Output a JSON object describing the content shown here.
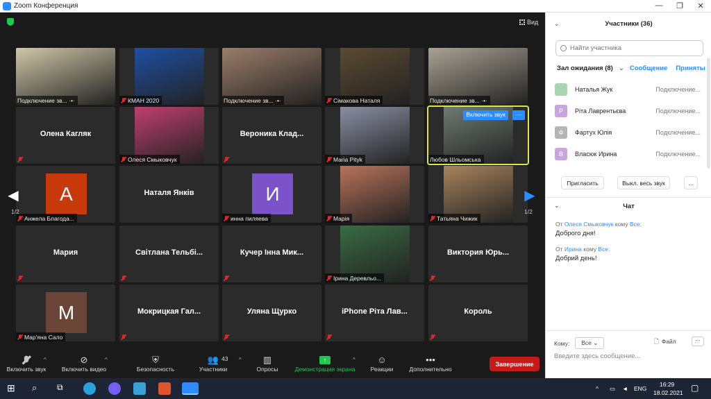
{
  "window": {
    "title": "Zoom Конференция",
    "view_label": "Вид"
  },
  "gallery": {
    "page_left": "1/2",
    "page_right": "1/2",
    "tiles": [
      {
        "name": "Подключение зв... ·•·",
        "type": "photo",
        "color": "#cfc7a8",
        "muted": false
      },
      {
        "name": "КМАН 2020",
        "type": "photo",
        "color": "#1e4fa3",
        "muted": true
      },
      {
        "name": "Подключение зв... ·•·",
        "type": "photo",
        "color": "#9a7d6a",
        "muted": false
      },
      {
        "name": "Сімакова Наталя",
        "type": "photo",
        "color": "#5b4a32",
        "muted": true
      },
      {
        "name": "Подключение зв... ·•·",
        "type": "photo",
        "color": "#a9a294",
        "muted": false
      },
      {
        "name": "Олена Кагляк",
        "type": "text",
        "muted": true
      },
      {
        "name": "Олеся Смыковчук",
        "type": "photo",
        "color": "#c03f6d",
        "muted": true
      },
      {
        "name": "Вероника  Клад...",
        "type": "text",
        "muted": true
      },
      {
        "name": "Maria Pityk",
        "type": "photo",
        "color": "#8b8fa3",
        "muted": true
      },
      {
        "name": "Любов Шльомська",
        "type": "photo",
        "color": "#6e7a72",
        "muted": false,
        "active": true
      },
      {
        "name": "Анжела Благода...",
        "type": "avatar",
        "letter": "A",
        "color": "#c8390c",
        "muted": true
      },
      {
        "name": "Наталя Янків",
        "type": "text",
        "muted": false
      },
      {
        "name": "инна пиляева",
        "type": "avatar",
        "letter": "И",
        "color": "#7b52c9",
        "muted": true
      },
      {
        "name": "Марія",
        "type": "photo",
        "color": "#b9735b",
        "muted": true
      },
      {
        "name": "Татьяна Чижик",
        "type": "photo",
        "color": "#a8845d",
        "muted": true
      },
      {
        "name": "Мария",
        "type": "text",
        "muted": true
      },
      {
        "name": "Світлана  Тельбі...",
        "type": "text",
        "muted": true
      },
      {
        "name": "Кучер Інна  Мик...",
        "type": "text",
        "muted": true
      },
      {
        "name": "Ірина Деревльо...",
        "type": "photo",
        "color": "#3a6b44",
        "muted": true
      },
      {
        "name": "Виктория  Юрь...",
        "type": "text",
        "muted": true
      },
      {
        "name": "Мар'яна Сало",
        "type": "avatar",
        "letter": "M",
        "color": "#6b4638",
        "muted": true
      },
      {
        "name": "Мокрицкая  Гал...",
        "type": "text",
        "muted": true
      },
      {
        "name": "Уляна Щурко",
        "type": "text",
        "muted": true
      },
      {
        "name": "iPhone  Рiта Лав...",
        "type": "text",
        "muted": true
      },
      {
        "name": "Король",
        "type": "text",
        "muted": true
      }
    ],
    "active_overlay": {
      "unmute": "Включить звук",
      "more": "···"
    }
  },
  "toolbar": {
    "mic": "Включить звук",
    "video": "Включить видео",
    "security": "Безопасность",
    "participants": "Участники",
    "participants_count": "43",
    "polls": "Опросы",
    "share": "Демонстрация экрана",
    "reactions": "Реакции",
    "more": "Дополнительно",
    "end": "Завершение"
  },
  "panel": {
    "participants_title": "Участники (36)",
    "search_placeholder": "Найти участника",
    "waiting_room": "Зал ожидания (8)",
    "message_link": "Сообщение",
    "admit_link": "Приняты",
    "waiting": [
      {
        "initial": "",
        "name": "Наталья Жук",
        "status": "Подключение...",
        "color": "#a8d5b0"
      },
      {
        "initial": "Р",
        "name": "Ріта Лаврентьєва",
        "status": "Подключение...",
        "color": "#c9a5e0"
      },
      {
        "initial": "Ф",
        "name": "Фартух Юлія",
        "status": "Подключение...",
        "color": "#b5b5b5"
      },
      {
        "initial": "В",
        "name": "Власюк Ирина",
        "status": "Подключение...",
        "color": "#c9a5e0"
      }
    ],
    "invite": "Пригласить",
    "mute_all": "Выкл. весь звук",
    "more": "...",
    "chat_title": "Чат",
    "messages": [
      {
        "from_label": "От",
        "from": "Олеся Смыковчук",
        "to_label": "кому",
        "to": "Все:",
        "text": "Доброго дня!"
      },
      {
        "from_label": "От",
        "from": "Ирина",
        "to_label": "кому",
        "to": "Все:",
        "text": "Добрий день!"
      }
    ],
    "to_label": "Кому:",
    "to_value": "Все",
    "file_label": "Файл",
    "input_placeholder": "Введите здесь сообщение..."
  },
  "taskbar": {
    "time": "16:29",
    "date": "18.02.2021",
    "lang": "ENG"
  }
}
